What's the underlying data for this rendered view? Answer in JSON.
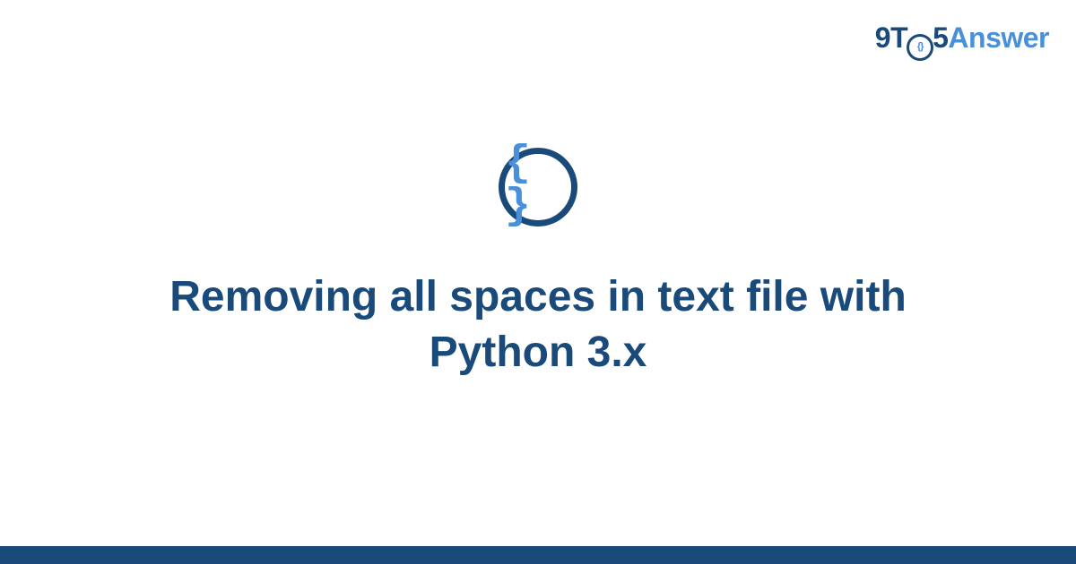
{
  "logo": {
    "part1": "9T",
    "circle_inner": "{}",
    "part2": "5",
    "part3": "Answer"
  },
  "icon": {
    "braces": "{ }"
  },
  "title": "Removing all spaces in text file with Python 3.x",
  "colors": {
    "primary": "#1a4a7a",
    "accent": "#4a90d9"
  }
}
